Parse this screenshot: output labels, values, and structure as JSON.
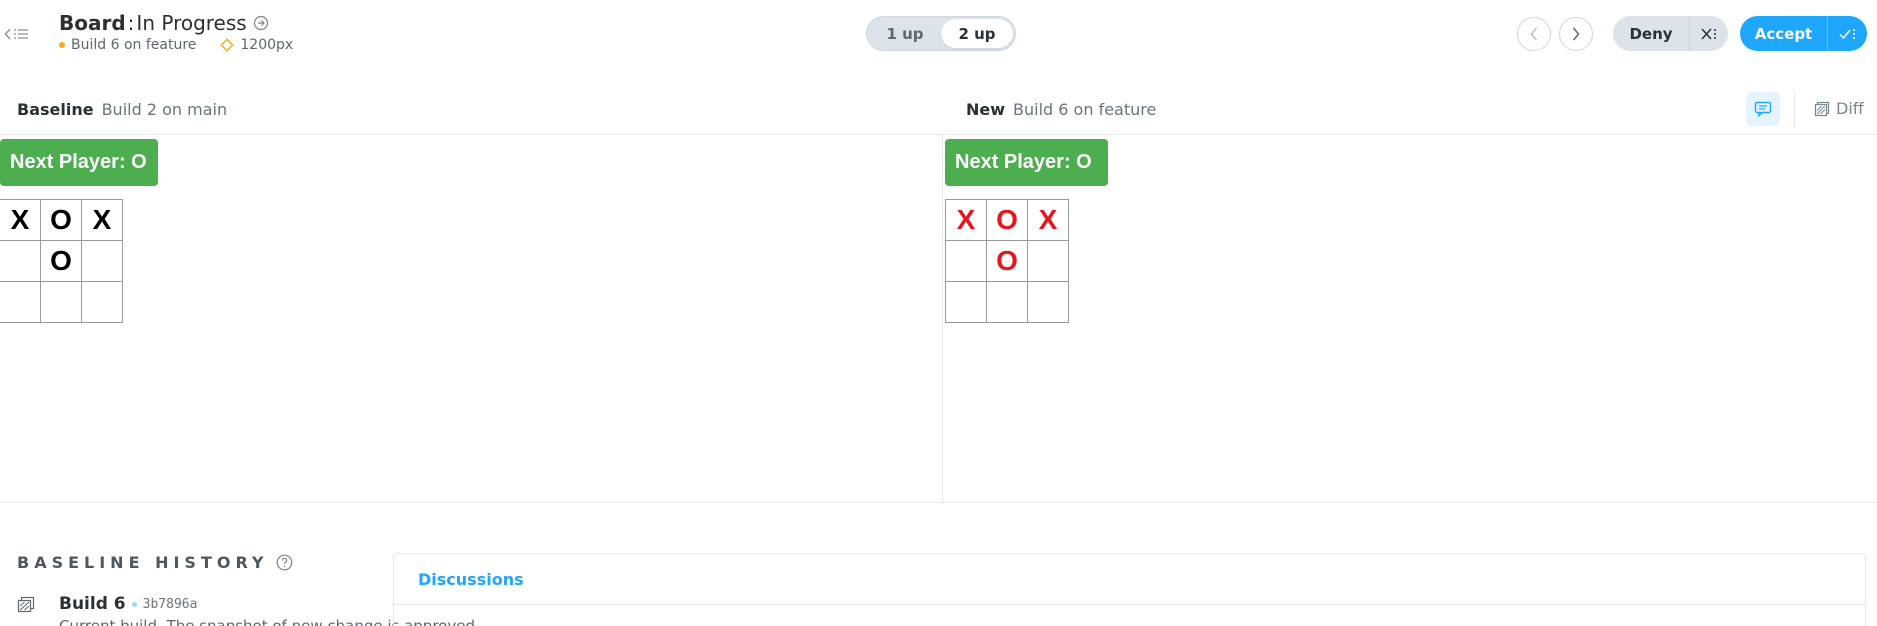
{
  "header": {
    "component": "Board",
    "separator": ":",
    "story": "In Progress",
    "build_label": "Build 6 on feature",
    "viewport": "1200px"
  },
  "view_toggle": {
    "one_up": "1 up",
    "two_up": "2 up",
    "active": "2 up"
  },
  "actions": {
    "deny": "Deny",
    "accept": "Accept"
  },
  "comparison": {
    "baseline_title": "Baseline",
    "baseline_build": "Build 2 on main",
    "new_title": "New",
    "new_build": "Build 6 on feature",
    "diff_label": "Diff"
  },
  "baseline_snapshot": {
    "status": "Next Player: O",
    "board": [
      "X",
      "O",
      "X",
      "",
      "O",
      "",
      "",
      "",
      ""
    ]
  },
  "new_snapshot": {
    "status": "Next Player: O",
    "board": [
      "X",
      "O",
      "X",
      "",
      "O",
      "",
      "",
      "",
      ""
    ]
  },
  "history": {
    "title": "BASELINE HISTORY",
    "items": [
      {
        "build": "Build 6",
        "sha": "3b7896a",
        "description": "Current build. The snapshot of new change is approved."
      }
    ]
  },
  "discussions": {
    "tab_label": "Discussions"
  },
  "colors": {
    "accent": "#1ea7fd",
    "badge_green": "#4cae4f",
    "changed_mark": "#e8161c",
    "build_dot": "#f6a818"
  },
  "icons": {
    "back": "chevron-left-icon",
    "list": "list-icon",
    "story_link": "arrow-circle-icon",
    "viewport": "diamond-icon",
    "prev": "chevron-left-icon",
    "next": "chevron-right-icon",
    "deny_batch": "batch-deny-icon",
    "accept_batch": "batch-accept-icon",
    "comments": "comment-icon",
    "diff": "diff-icon",
    "help": "question-circle-icon",
    "history_build": "build-icon"
  }
}
